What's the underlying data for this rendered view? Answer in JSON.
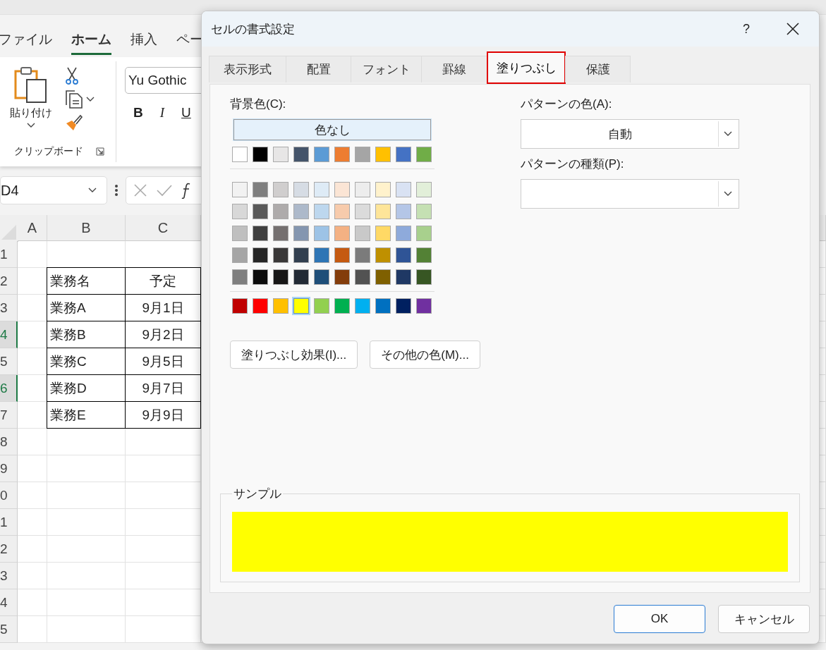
{
  "ribbon_tabs": [
    {
      "label": "ファイル",
      "selected": false
    },
    {
      "label": "ホーム",
      "selected": true
    },
    {
      "label": "挿入",
      "selected": false
    },
    {
      "label": "ペー",
      "selected": false
    }
  ],
  "clipboard": {
    "paste_label": "貼り付け",
    "group_label": "クリップボード"
  },
  "font_group": {
    "font_name": "Yu Gothic",
    "buttons": [
      "B",
      "I",
      "U"
    ]
  },
  "formula_bar": {
    "name_box": "D4"
  },
  "sheet": {
    "columns": [
      "A",
      "B",
      "C"
    ],
    "rows": [
      {
        "number": "1",
        "selected": false,
        "cells": [
          "",
          ""
        ]
      },
      {
        "number": "2",
        "selected": false,
        "cells": [
          "業務名",
          "予定"
        ]
      },
      {
        "number": "3",
        "selected": false,
        "cells": [
          "業務A",
          "9月1日"
        ]
      },
      {
        "number": "4",
        "selected": true,
        "cells": [
          "業務B",
          "9月2日"
        ]
      },
      {
        "number": "5",
        "selected": false,
        "cells": [
          "業務C",
          "9月5日"
        ]
      },
      {
        "number": "6",
        "selected": true,
        "cells": [
          "業務D",
          "9月7日"
        ]
      },
      {
        "number": "7",
        "selected": false,
        "cells": [
          "業務E",
          "9月9日"
        ]
      },
      {
        "number": "8",
        "selected": false,
        "cells": [
          "",
          ""
        ]
      },
      {
        "number": "9",
        "selected": false,
        "cells": [
          "",
          ""
        ]
      },
      {
        "number": "0",
        "selected": false,
        "cells": [
          "",
          ""
        ]
      },
      {
        "number": "1",
        "selected": false,
        "cells": [
          "",
          ""
        ]
      },
      {
        "number": "2",
        "selected": false,
        "cells": [
          "",
          ""
        ]
      },
      {
        "number": "3",
        "selected": false,
        "cells": [
          "",
          ""
        ]
      },
      {
        "number": "4",
        "selected": false,
        "cells": [
          "",
          ""
        ]
      },
      {
        "number": "5",
        "selected": false,
        "cells": [
          "",
          ""
        ]
      }
    ]
  },
  "dialog": {
    "title": "セルの書式設定",
    "help": "?",
    "tabs": [
      {
        "label": "表示形式",
        "selected": false,
        "highlighted": false
      },
      {
        "label": "配置",
        "selected": false,
        "highlighted": false
      },
      {
        "label": "フォント",
        "selected": false,
        "highlighted": false
      },
      {
        "label": "罫線",
        "selected": false,
        "highlighted": false
      },
      {
        "label": "塗りつぶし",
        "selected": true,
        "highlighted": true
      },
      {
        "label": "保護",
        "selected": false,
        "highlighted": false
      }
    ],
    "background_label": "背景色(C):",
    "no_color_button": "色なし",
    "theme_colors": [
      {
        "color": "#ffffff",
        "selected": false
      },
      {
        "color": "#000000",
        "selected": false
      },
      {
        "color": "#e7e6e6",
        "selected": false
      },
      {
        "color": "#44546a",
        "selected": false
      },
      {
        "color": "#5b9bd5",
        "selected": false
      },
      {
        "color": "#ed7d31",
        "selected": false
      },
      {
        "color": "#a5a5a5",
        "selected": false
      },
      {
        "color": "#ffc000",
        "selected": false
      },
      {
        "color": "#4472c4",
        "selected": false
      },
      {
        "color": "#70ad47",
        "selected": false
      }
    ],
    "shades": [
      [
        {
          "color": "#f2f2f2",
          "selected": false
        },
        {
          "color": "#7f7f7f",
          "selected": false
        },
        {
          "color": "#d0cece",
          "selected": false
        },
        {
          "color": "#d6dce4",
          "selected": false
        },
        {
          "color": "#deebf6",
          "selected": false
        },
        {
          "color": "#fbe5d5",
          "selected": false
        },
        {
          "color": "#ededed",
          "selected": false
        },
        {
          "color": "#fff2cc",
          "selected": false
        },
        {
          "color": "#d9e2f3",
          "selected": false
        },
        {
          "color": "#e2efd9",
          "selected": false
        }
      ],
      [
        {
          "color": "#d8d8d8",
          "selected": false
        },
        {
          "color": "#595959",
          "selected": false
        },
        {
          "color": "#aeabab",
          "selected": false
        },
        {
          "color": "#adb9ca",
          "selected": false
        },
        {
          "color": "#bdd7ee",
          "selected": false
        },
        {
          "color": "#f7cbac",
          "selected": false
        },
        {
          "color": "#dbdbdb",
          "selected": false
        },
        {
          "color": "#fee599",
          "selected": false
        },
        {
          "color": "#b4c6e7",
          "selected": false
        },
        {
          "color": "#c5e0b3",
          "selected": false
        }
      ],
      [
        {
          "color": "#bfbfbf",
          "selected": false
        },
        {
          "color": "#3f3f3f",
          "selected": false
        },
        {
          "color": "#757070",
          "selected": false
        },
        {
          "color": "#8496b0",
          "selected": false
        },
        {
          "color": "#9dc3e6",
          "selected": false
        },
        {
          "color": "#f4b183",
          "selected": false
        },
        {
          "color": "#c9c9c9",
          "selected": false
        },
        {
          "color": "#ffd965",
          "selected": false
        },
        {
          "color": "#8eaadb",
          "selected": false
        },
        {
          "color": "#a8d08d",
          "selected": false
        }
      ],
      [
        {
          "color": "#a5a5a5",
          "selected": false
        },
        {
          "color": "#262626",
          "selected": false
        },
        {
          "color": "#3a3838",
          "selected": false
        },
        {
          "color": "#323f4f",
          "selected": false
        },
        {
          "color": "#2e75b5",
          "selected": false
        },
        {
          "color": "#c55a11",
          "selected": false
        },
        {
          "color": "#7b7b7b",
          "selected": false
        },
        {
          "color": "#bf9000",
          "selected": false
        },
        {
          "color": "#2f5496",
          "selected": false
        },
        {
          "color": "#538135",
          "selected": false
        }
      ],
      [
        {
          "color": "#7f7f7f",
          "selected": false
        },
        {
          "color": "#0c0c0c",
          "selected": false
        },
        {
          "color": "#171616",
          "selected": false
        },
        {
          "color": "#222a35",
          "selected": false
        },
        {
          "color": "#1e4e79",
          "selected": false
        },
        {
          "color": "#833c0b",
          "selected": false
        },
        {
          "color": "#525252",
          "selected": false
        },
        {
          "color": "#7f6000",
          "selected": false
        },
        {
          "color": "#1f3864",
          "selected": false
        },
        {
          "color": "#375623",
          "selected": false
        }
      ]
    ],
    "standard_colors": [
      {
        "color": "#c00000",
        "selected": false
      },
      {
        "color": "#ff0000",
        "selected": false
      },
      {
        "color": "#ffc000",
        "selected": false
      },
      {
        "color": "#ffff00",
        "selected": true
      },
      {
        "color": "#92d050",
        "selected": false
      },
      {
        "color": "#00b050",
        "selected": false
      },
      {
        "color": "#00b0f0",
        "selected": false
      },
      {
        "color": "#0070c0",
        "selected": false
      },
      {
        "color": "#002060",
        "selected": false
      },
      {
        "color": "#7030a0",
        "selected": false
      }
    ],
    "fill_effects_button": "塗りつぶし効果(I)...",
    "more_colors_button": "その他の色(M)...",
    "pattern_color_label": "パターンの色(A):",
    "pattern_color": "自動",
    "pattern_style_label": "パターンの種類(P):",
    "sample_label": "サンプル",
    "sample": {
      "color": "#ffff00"
    },
    "buttons": [
      {
        "label": "OK",
        "default": true
      },
      {
        "label": "キャンセル",
        "default": false
      }
    ]
  }
}
